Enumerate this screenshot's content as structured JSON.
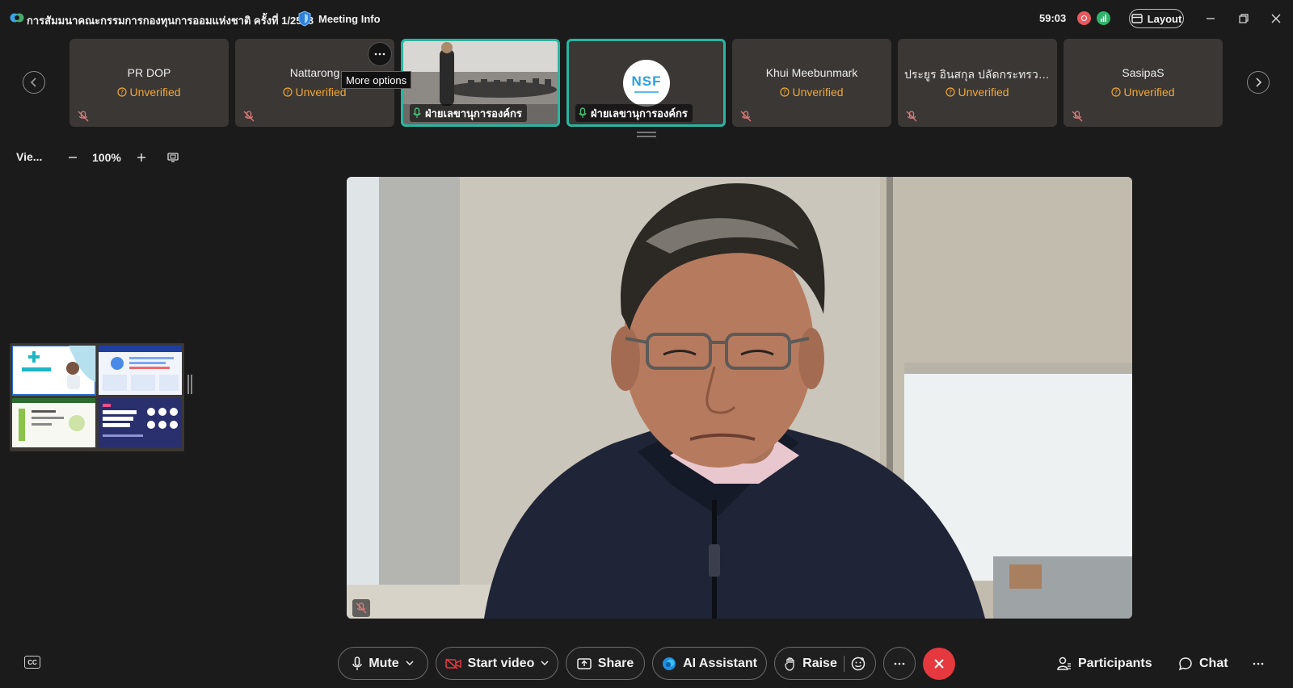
{
  "titlebar": {
    "meeting_title": "การสัมมนาคณะกรรมการกองทุนการออมแห่งชาติ ครั้งที่ 1/2568",
    "meeting_info_label": "Meeting Info",
    "timer": "59:03",
    "layout_label": "Layout",
    "icons": [
      "webex-logo-icon",
      "shield-icon",
      "recording-icon",
      "network-health-icon",
      "layout-icon",
      "minimize-icon",
      "restore-icon",
      "close-icon"
    ]
  },
  "participants": [
    {
      "name": "PR DOP",
      "status": "Unverified",
      "muted": true,
      "active": false
    },
    {
      "name": "Nattarong",
      "status": "Unverified",
      "muted": true,
      "active": false
    },
    {
      "name": "ฝ่ายเลขานุการองค์กร",
      "status": "",
      "muted": false,
      "active": true,
      "video": true
    },
    {
      "name": "ฝ่ายเลขานุการองค์กร",
      "status": "",
      "muted": false,
      "active": true,
      "avatar_logo": "NSF"
    },
    {
      "name": "Khui Meebunmark",
      "status": "Unverified",
      "muted": true,
      "active": false
    },
    {
      "name": "ประยูร อินสกุล ปลัดกระทรวง...",
      "status": "Unverified",
      "muted": true,
      "active": false
    },
    {
      "name": "SasipaS",
      "status": "Unverified",
      "muted": true,
      "active": false
    }
  ],
  "tooltip": "More options",
  "view": {
    "label": "Vie...",
    "zoom": "100%"
  },
  "main_video": {
    "muted": true
  },
  "toolbar": {
    "mute_label": "Mute",
    "video_label": "Start video",
    "share_label": "Share",
    "ai_label": "AI Assistant",
    "raise_label": "Raise",
    "participants_label": "Participants",
    "chat_label": "Chat",
    "cc_label": "CC"
  },
  "colors": {
    "background": "#1b1b1b",
    "tile": "#3a3735",
    "active_border": "#2bb5a0",
    "unverified": "#f0a93a",
    "leave": "#e5383f",
    "mute_icon": "#e07a7a"
  }
}
